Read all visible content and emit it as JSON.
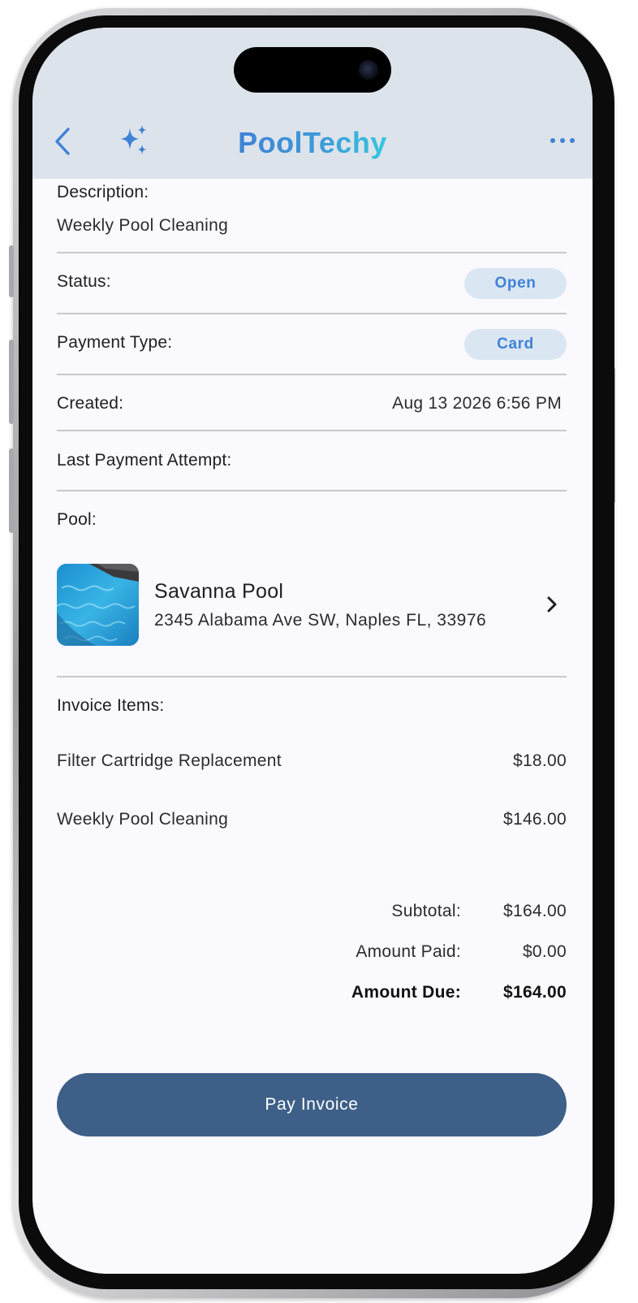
{
  "header": {
    "brand": "PoolTechy"
  },
  "icons": {
    "back": "chevron-left-icon",
    "ai": "sparkles-icon",
    "more": "ellipsis-icon",
    "pool_chevron": "chevron-right-icon"
  },
  "colors": {
    "accent": "#3f82d6",
    "header_bg": "#dde3ea",
    "chip_bg": "#dbe6f3",
    "primary_button": "#3d5f88"
  },
  "invoice": {
    "description_label": "Description:",
    "description_value": "Weekly Pool Cleaning",
    "status_label": "Status:",
    "status_value": "Open",
    "payment_type_label": "Payment Type:",
    "payment_type_value": "Card",
    "created_label": "Created:",
    "created_value": "Aug 13 2026 6:56 PM",
    "last_payment_label": "Last Payment Attempt:",
    "pool_label": "Pool:"
  },
  "pool": {
    "name": "Savanna Pool",
    "address": "2345 Alabama Ave SW, Naples FL, 33976"
  },
  "items": {
    "heading": "Invoice Items:",
    "rows": [
      {
        "name": "Filter Cartridge Replacement",
        "price": "$18.00"
      },
      {
        "name": "Weekly Pool Cleaning",
        "price": "$146.00"
      }
    ]
  },
  "totals": {
    "subtotal_label": "Subtotal:",
    "subtotal_value": "$164.00",
    "paid_label": "Amount Paid:",
    "paid_value": "$0.00",
    "due_label": "Amount Due:",
    "due_value": "$164.00"
  },
  "actions": {
    "pay_label": "Pay Invoice"
  }
}
